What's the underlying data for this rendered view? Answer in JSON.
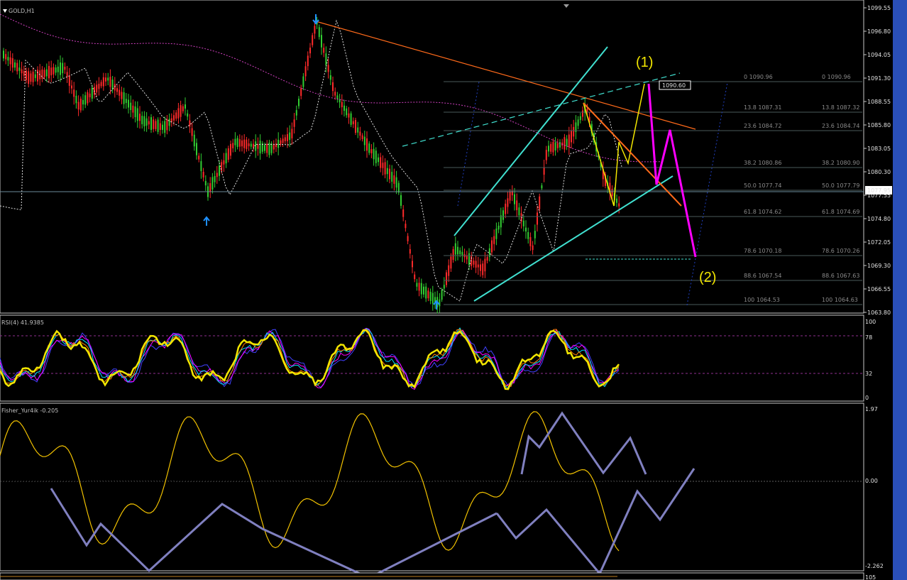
{
  "window": {
    "symbol_label": "GOLD,H1",
    "current_price_label": "1077.95",
    "marker_label": "1090.60"
  },
  "colors": {
    "background": "#000000",
    "grid_border": "#c8c8c8",
    "bull_candle": "#32cd32",
    "bear_candle": "#ff2a2a",
    "trendline": "#ff6a1a",
    "channel": "#40e0d0",
    "wave_pink": "#ff00ff",
    "wave_yellow": "#f2e600",
    "fractal_arrow": "#1e90ff",
    "arrows_gray": "#8080c0"
  },
  "main_panel": {
    "price_axis": [
      "1099.55",
      "1096.80",
      "1094.05",
      "1091.30",
      "1088.55",
      "1085.80",
      "1083.05",
      "1080.30",
      "1077.55",
      "1074.80",
      "1072.05",
      "1069.30",
      "1066.55",
      "1063.80"
    ],
    "fib_left": [
      "0 1090.96",
      "13.8 1087.31",
      "23.6 1084.72",
      "38.2 1080.86",
      "50.0 1077.74",
      "61.8 1074.62",
      "78.6 1070.18",
      "88.6 1067.54",
      "100 1064.53"
    ],
    "fib_right": [
      "0 1090.96",
      "13.8 1087.32",
      "23.6 1084.74",
      "38.2 1080.90",
      "50.0 1077.79",
      "61.8 1074.69",
      "78.6 1070.26",
      "88.6 1067.63",
      "100 1064.63"
    ],
    "wave_labels": [
      "(1)",
      "(2)"
    ]
  },
  "rsi_panel": {
    "title": "RSI(4) 41.9385",
    "axis": [
      "100",
      "78",
      "32",
      "0"
    ]
  },
  "fisher_panel": {
    "title": "Fisher_Yur4ik -0.205",
    "axis": [
      "1.97",
      "0.00",
      "-2.262"
    ]
  },
  "bottom_panel": {
    "axis": [
      "105"
    ]
  }
}
